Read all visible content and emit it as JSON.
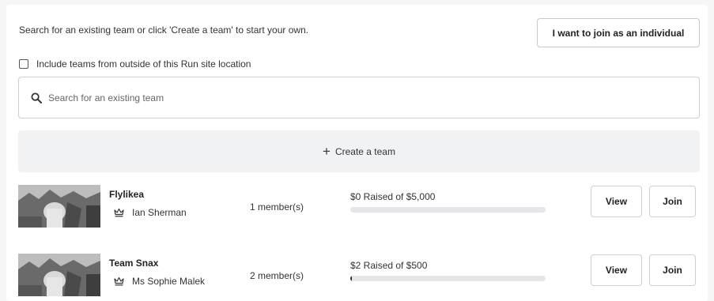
{
  "intro_text": "Search for an existing team or click 'Create a team' to start your own.",
  "individual_button_label": "I want to join as an individual",
  "include_outside_label": "Include teams from outside of this Run site location",
  "include_outside_checked": false,
  "search": {
    "placeholder": "Search for an existing team",
    "value": ""
  },
  "create_team_label": "Create a team",
  "icons": {
    "search": "search-icon",
    "create": "plus-icon",
    "captain": "crown-icon",
    "checkbox": "checkbox-icon"
  },
  "teams": [
    {
      "name": "Flylikea",
      "captain": "Ian Sherman",
      "members": "1 member(s)",
      "raised_text": "$0 Raised of $5,000",
      "progress_fraction": 0.0,
      "view_label": "View",
      "join_label": "Join"
    },
    {
      "name": "Team Snax",
      "captain": "Ms Sophie Malek",
      "members": "2 member(s)",
      "raised_text": "$2 Raised of $500",
      "progress_fraction": 0.004,
      "view_label": "View",
      "join_label": "Join"
    }
  ],
  "colors": {
    "progress_fill": "#2c2c2c",
    "progress_track": "#e4e6e9",
    "create_bg": "#f1f2f4"
  }
}
